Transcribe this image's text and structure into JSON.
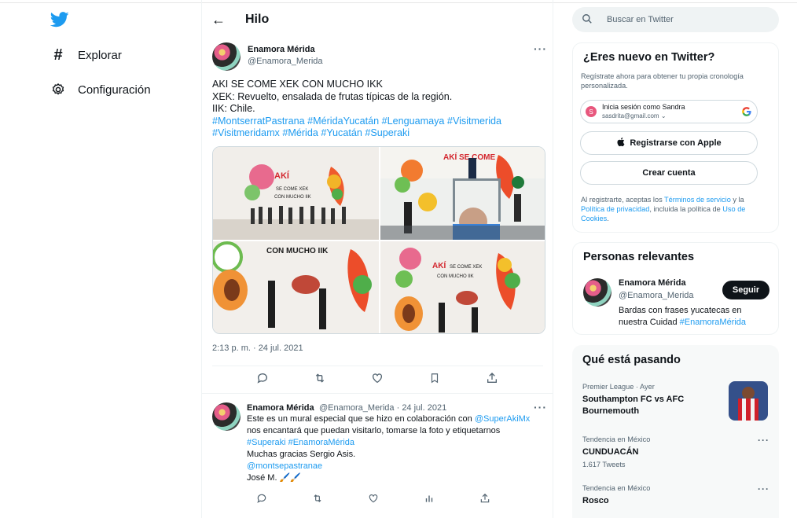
{
  "nav": {
    "items": [
      {
        "label": "Explorar",
        "icon": "hash-icon"
      },
      {
        "label": "Configuración",
        "icon": "gear-icon"
      }
    ]
  },
  "header": {
    "title": "Hilo"
  },
  "tweet": {
    "name": "Enamora Mérida",
    "handle": "@Enamora_Merida",
    "line1": "AKI SE COME XEK CON MUCHO IKK",
    "line2": "XEK: Revuelto, ensalada de frutas típicas de la región.",
    "line3": "IIK: Chile.",
    "hashtags1": "#MontserratPastrana #MéridaYucatán #Lenguamaya #Visitmerida",
    "hashtags2": "#Visitmeridamx #Mérida #Yucatán #Superaki",
    "timestamp": "2:13 p. m. · 24 jul. 2021"
  },
  "reply": {
    "name": "Enamora Mérida",
    "meta": "@Enamora_Merida · 24 jul. 2021",
    "line1a": "Este es un mural especial que se hizo en colaboración con ",
    "line1b": "@SuperAkiMx",
    "line2": "nos encantará que puedan visitarlo, tomarse la foto y etiquetarnos",
    "line3": "#Superaki #EnamoraMérida",
    "line4": "Muchas gracias Sergio Asis.",
    "line5": "@montsepastranae",
    "line6": "José M. 🖌️🖌️"
  },
  "search": {
    "placeholder": "Buscar en Twitter"
  },
  "signup": {
    "title": "¿Eres nuevo en Twitter?",
    "subtitle_1": "Regístrate ahora para obtener tu propia cronología",
    "subtitle_2": "personalizada.",
    "google_label": "Inicia sesión como Sandra",
    "google_email": "sasdrita@gmail.com",
    "google_initial": "S",
    "apple_label": "Registrarse con Apple",
    "create_label": "Crear cuenta",
    "legal_1a": "Al registrarte, aceptas los ",
    "legal_1b": "Términos de servicio",
    "legal_1c": " y la",
    "legal_2a": "Política de privacidad",
    "legal_2b": ", incluida la política de ",
    "legal_2c": "Uso de",
    "legal_3": "Cookies",
    "legal_3b": "."
  },
  "relevant": {
    "title": "Personas relevantes",
    "name": "Enamora Mérida",
    "handle": "@Enamora_Merida",
    "follow": "Seguir",
    "bio1": "Bardas con frases yucatecas en",
    "bio2a": "nuestra Cuidad ",
    "bio2b": "#EnamoraMérida"
  },
  "trends": {
    "title": "Qué está pasando",
    "items": [
      {
        "meta": "Premier League · Ayer",
        "name1": "Southampton FC vs AFC",
        "name2": "Bournemouth"
      },
      {
        "meta": "Tendencia en México",
        "name1": "CUNDUACÁN",
        "count": "1.617 Tweets"
      },
      {
        "meta": "Tendencia en México",
        "name1": "Rosco"
      }
    ]
  },
  "colors": {
    "accent": "#1d9bf0",
    "text": "#0f1419",
    "muted": "#536471"
  }
}
